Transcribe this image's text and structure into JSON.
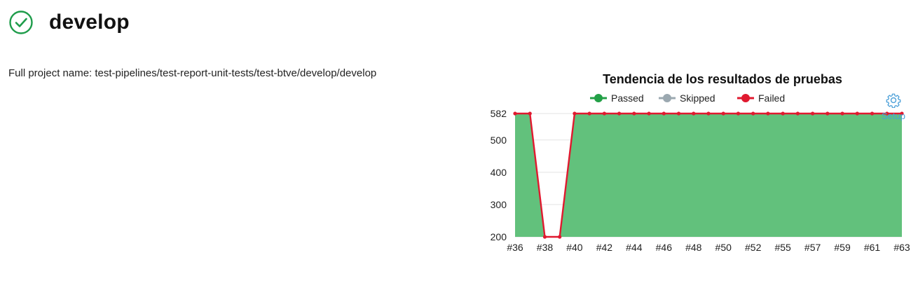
{
  "header": {
    "title": "develop",
    "status_icon": "check-circle-icon",
    "status_color": "#1e9c4a"
  },
  "project": {
    "full_name_text": "Full project name: test-pipelines/test-report-unit-tests/test-btve/develop/develop"
  },
  "setup": {
    "icon": "gear-icon",
    "label": "Setup"
  },
  "chart_data": {
    "type": "area",
    "title": "Tendencia de los resultados de pruebas",
    "legend_position": "top",
    "grid": true,
    "ylim": [
      200,
      582
    ],
    "y_ticks": [
      582,
      500,
      400,
      300,
      200
    ],
    "x_tick_labels": [
      "#36",
      "#38",
      "#40",
      "#42",
      "#44",
      "#46",
      "#48",
      "#50",
      "#52",
      "#55",
      "#57",
      "#59",
      "#61",
      "#63"
    ],
    "x": [
      "#36",
      "#37",
      "#38",
      "#39",
      "#40",
      "#41",
      "#42",
      "#43",
      "#44",
      "#45",
      "#46",
      "#47",
      "#48",
      "#49",
      "#50",
      "#51",
      "#52",
      "#53",
      "#55",
      "#56",
      "#57",
      "#58",
      "#59",
      "#60",
      "#61",
      "#62",
      "#63"
    ],
    "series": [
      {
        "name": "Passed",
        "color": "#23a047",
        "fill": "#62c17c",
        "values": [
          582,
          582,
          200,
          200,
          582,
          582,
          582,
          582,
          582,
          582,
          582,
          582,
          582,
          582,
          582,
          582,
          582,
          582,
          582,
          582,
          582,
          582,
          582,
          582,
          582,
          582,
          582
        ]
      },
      {
        "name": "Skipped",
        "color": "#9ba8b0",
        "values": [
          0,
          0,
          0,
          0,
          0,
          0,
          0,
          0,
          0,
          0,
          0,
          0,
          0,
          0,
          0,
          0,
          0,
          0,
          0,
          0,
          0,
          0,
          0,
          0,
          0,
          0,
          0
        ]
      },
      {
        "name": "Failed",
        "color": "#e0192f",
        "values": [
          582,
          582,
          200,
          200,
          582,
          582,
          582,
          582,
          582,
          582,
          582,
          582,
          582,
          582,
          582,
          582,
          582,
          582,
          582,
          582,
          582,
          582,
          582,
          582,
          582,
          582,
          582
        ]
      }
    ]
  }
}
